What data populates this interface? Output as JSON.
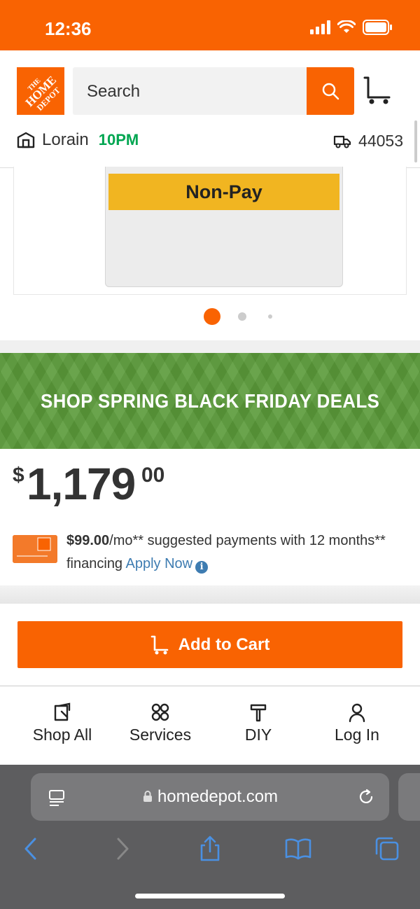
{
  "status_bar": {
    "time": "12:36"
  },
  "header": {
    "logo_text": [
      "THE",
      "HOME",
      "DEPOT"
    ],
    "search_placeholder": "Search",
    "store": {
      "name": "Lorain",
      "hours": "10PM"
    },
    "delivery_zip": "44053"
  },
  "product_image": {
    "card_label": "Non-Pay",
    "carousel": {
      "total": 3,
      "active": 1
    }
  },
  "promo": {
    "text": "SHOP SPRING BLACK FRIDAY DEALS"
  },
  "price": {
    "currency": "$",
    "whole": "1,179",
    "cents": "00"
  },
  "financing": {
    "amount": "$99.00",
    "per": "/mo**",
    "text": " suggested payments with 12 months** financing ",
    "link": "Apply Now"
  },
  "add_to_cart": {
    "label": "Add to Cart"
  },
  "bottom_nav": {
    "items": [
      {
        "label": "Shop All",
        "icon": "shop-all-icon"
      },
      {
        "label": "Services",
        "icon": "services-icon"
      },
      {
        "label": "DIY",
        "icon": "diy-icon"
      },
      {
        "label": "Log In",
        "icon": "user-icon"
      }
    ]
  },
  "browser": {
    "url": "homedepot.com"
  },
  "colors": {
    "brand": "#f96302",
    "green": "#00a651",
    "promo_green": "#5a9a39",
    "link": "#3e7cb1",
    "badge_yellow": "#f1b521"
  }
}
